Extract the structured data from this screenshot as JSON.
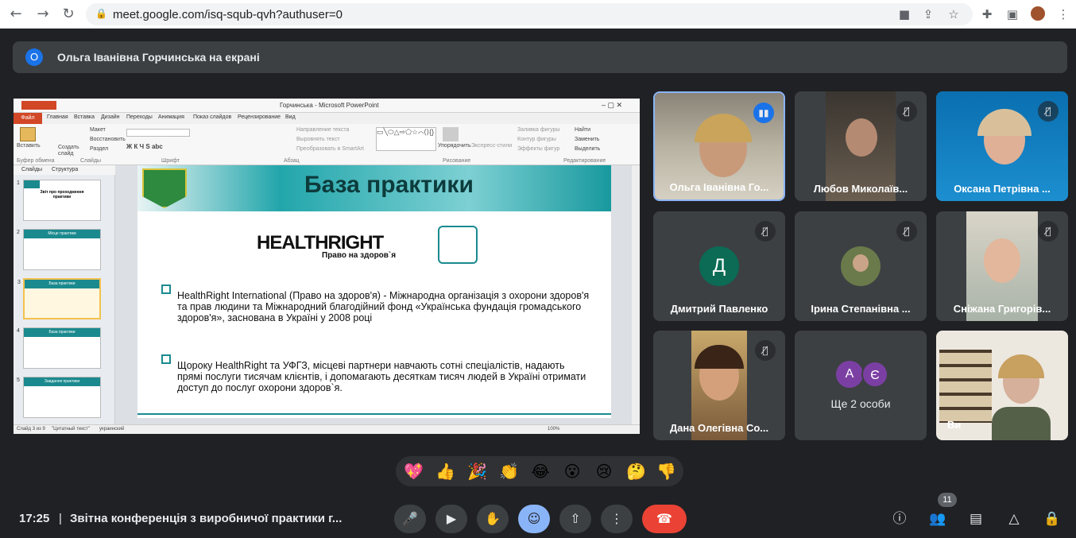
{
  "browser": {
    "url": "meet.google.com/isq-squb-qvh?authuser=0",
    "icons": [
      "back-icon",
      "forward-icon",
      "reload-icon",
      "lock-icon",
      "camera-icon",
      "share-icon",
      "star-icon",
      "extensions-icon",
      "sidebar-icon",
      "profile-avatar",
      "menu-icon"
    ]
  },
  "banner": {
    "badge": "О",
    "text": "Ольга Іванівна Горчинська на екрані"
  },
  "presentation": {
    "window_title": "Горчинська - Microsoft PowerPoint",
    "file_tab": "Файл",
    "tabs": [
      "Главная",
      "Вставка",
      "Дизайн",
      "Переходы",
      "Анимация",
      "Показ слайдов",
      "Рецензирование",
      "Вид"
    ],
    "ribbon": {
      "paste": "Вставить",
      "new_slide": "Создать слайд",
      "layout": "Макет",
      "reset": "Восстановить",
      "section": "Раздел",
      "group_clipboard": "Буфер обмена",
      "group_slides": "Слайды",
      "group_font": "Шрифт",
      "group_paragraph": "Абзац",
      "group_drawing": "Рисование",
      "group_editing": "Редактирование",
      "text_direction": "Направление текста",
      "align_text": "Выровнять текст",
      "smartart": "Преобразовать в SmartArt",
      "arrange": "Упорядочить",
      "quick_styles": "Экспресс-стили",
      "shape_fill": "Заливка фигуры",
      "shape_outline": "Контур фигуры",
      "shape_effects": "Эффекты фигур",
      "find": "Найти",
      "replace": "Заменить",
      "select": "Выделить"
    },
    "pane_tabs": [
      "Слайды",
      "Структура"
    ],
    "thumbnails": [
      {
        "num": "1",
        "title": "Звіт про проходження практики"
      },
      {
        "num": "2",
        "title": "Місце практики"
      },
      {
        "num": "3",
        "title": "База практики"
      },
      {
        "num": "4",
        "title": "База практики"
      },
      {
        "num": "5",
        "title": "Завдання практики"
      }
    ],
    "slide": {
      "title": "База практики",
      "logo_text": "HEALTHRIGHT",
      "logo_sub": "Право на здоров`я",
      "paragraph1": "HealthRight International (Право на здоров'я) - Міжнародна організація з охорони здоров'я та прав людини та Міжнародний благодійний фонд «Українська фундація громадського здоров'я», заснована в Україні у 2008 році",
      "paragraph2": "Щороку HealthRight та УФГЗ, місцеві партнери навчають сотні спеціалістів, надають прямі послуги тисячам клієнтів, і допомагають десяткам тисяч людей в Україні отримати доступ до послуг охорони здоров`я."
    },
    "statusbar": {
      "slide_info": "Слайд 3 из 9",
      "theme": "\"Цитатный текст\"",
      "language": "украинский",
      "zoom": "100%"
    }
  },
  "participants": [
    {
      "name": "Ольга Іванівна Го...",
      "state": "speaking"
    },
    {
      "name": "Любов Миколаїв...",
      "state": "muted"
    },
    {
      "name": "Оксана Петрівна ...",
      "state": "muted"
    },
    {
      "name": "Дмитрий Павленко",
      "state": "muted",
      "initial": "Д",
      "color": "#0b6b55"
    },
    {
      "name": "Ірина Степанівна ...",
      "state": "muted"
    },
    {
      "name": "Сніжана Григорів...",
      "state": "muted"
    },
    {
      "name": "Дана Олегівна Со...",
      "state": "muted"
    },
    {
      "name": "Ще 2 особи",
      "initials": [
        "А",
        "Є"
      ],
      "color": "#7b3fa4"
    },
    {
      "name": "Ви",
      "state": "self"
    }
  ],
  "reactions": [
    "💖",
    "👍",
    "🎉",
    "👏",
    "😂",
    "😮",
    "😢",
    "🤔",
    "👎"
  ],
  "bottom_bar": {
    "time": "17:25",
    "meeting_title": "Звітна конференція з виробничої практики г...",
    "people_count": "11",
    "controls": [
      "mic-button",
      "camera-button",
      "raise-hand-button",
      "emoji-button",
      "present-button",
      "more-options-button",
      "leave-call-button"
    ],
    "right_icons": [
      "info-icon",
      "people-icon",
      "chat-icon",
      "activities-icon",
      "host-controls-icon"
    ],
    "leave_color": "#ea4335",
    "accent": "#8ab4f8"
  }
}
